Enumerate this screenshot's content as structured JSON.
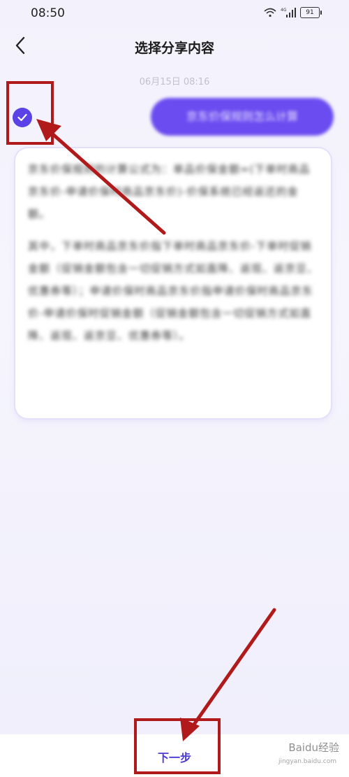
{
  "status_bar": {
    "time": "08:50",
    "battery": "91"
  },
  "nav": {
    "title": "选择分享内容"
  },
  "chat": {
    "timestamp": "06月15日 08:16",
    "user_message": "京东价保规则怎么计算",
    "reply_paragraphs": [
      "京东价保规则的计算公式为：单品价保金额=(下单时商品京东价-申请价保时商品京东价)-价保系统已经返还的金额。",
      "其中，下单时商品京东价指下单时商品京东价-下单时促销金额（促销金额包含一切促销方式如直降、返现、返京豆、优惠券等）；申请价保时商品京东价指申请价保时商品京东价-申请价保时促销金额（促销金额包含一切促销方式如直降、返现、返京豆、优惠券等）。"
    ]
  },
  "footer": {
    "next_label": "下一步"
  },
  "watermark": {
    "brand": "Baidu经验",
    "url": "jingyan.baidu.com"
  },
  "colors": {
    "accent": "#5a42e6",
    "annotation": "#b01a1a"
  }
}
